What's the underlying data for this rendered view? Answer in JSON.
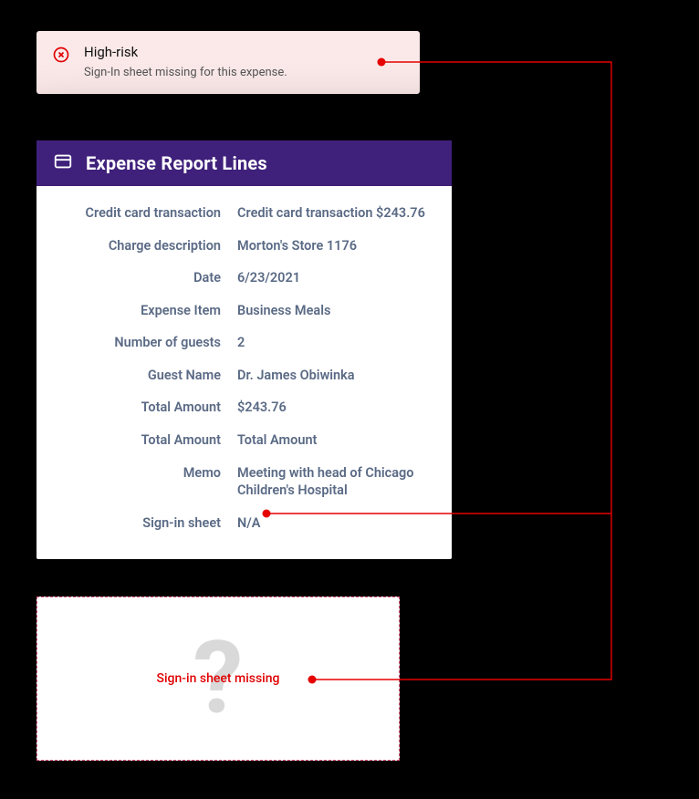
{
  "alert": {
    "title": "High-risk",
    "message": "Sign-In sheet missing for this expense."
  },
  "card": {
    "title": "Expense Report Lines",
    "rows": [
      {
        "label": "Credit card transaction",
        "value": "Credit card transaction $243.76"
      },
      {
        "label": "Charge description",
        "value": "Morton's Store 1176"
      },
      {
        "label": "Date",
        "value": "6/23/2021"
      },
      {
        "label": "Expense Item",
        "value": "Business Meals"
      },
      {
        "label": "Number of guests",
        "value": "2"
      },
      {
        "label": "Guest Name",
        "value": "Dr. James Obiwinka"
      },
      {
        "label": "Total Amount",
        "value": "$243.76"
      },
      {
        "label": "Total Amount",
        "value": "Total Amount"
      },
      {
        "label": "Memo",
        "value": "Meeting with head of Chicago Children's Hospital"
      },
      {
        "label": "Sign-in sheet",
        "value": "N/A"
      }
    ]
  },
  "missing": {
    "label": "Sign-in sheet missing"
  },
  "colors": {
    "header_bg": "#3f207a",
    "alert_bg": "#fbe9e9",
    "error_red": "#e00000",
    "connector_red": "#e60000",
    "text_muted": "#5a6a85"
  }
}
